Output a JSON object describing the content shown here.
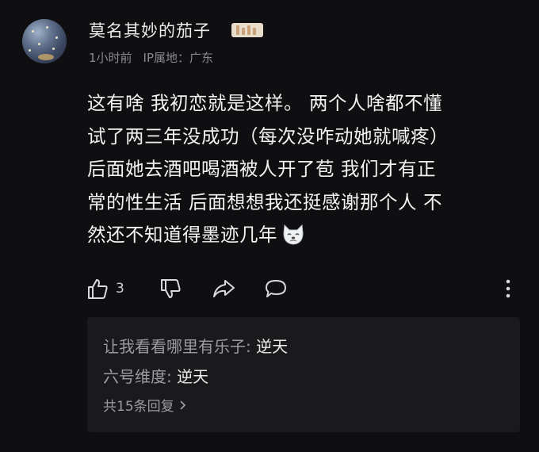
{
  "post": {
    "username": "莫名其妙的茄子",
    "time": "1小时前",
    "ip_location": "IP属地：广东",
    "body_lines": [
      "这有啥 我初恋就是这样。 两个人啥都不懂",
      "试了两三年没成功（每次没咋动她就喊疼）",
      "后面她去酒吧喝酒被人开了苞  我们才有正",
      "常的性生活  后面想想我还挺感谢那个人  不",
      "然还不知道得墨迹几年"
    ],
    "like_count": "3"
  },
  "replies": {
    "items": [
      {
        "author": "让我看看哪里有乐子",
        "text": "逆天"
      },
      {
        "author": "六号维度",
        "text": "逆天"
      }
    ],
    "more_label": "共15条回复"
  },
  "icons": {
    "like": "thumbs-up-icon",
    "dislike": "thumbs-down-icon",
    "share": "share-icon",
    "comment": "comment-icon",
    "more": "more-vertical-icon",
    "badge": "level-badge-icon",
    "emoji": "dog-emoji-icon"
  }
}
